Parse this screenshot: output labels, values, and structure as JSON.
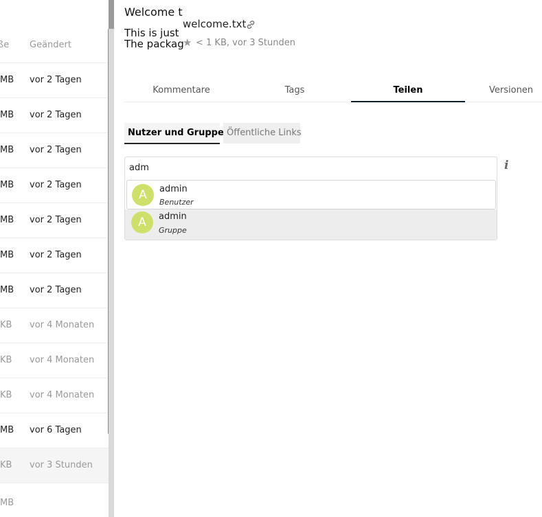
{
  "filelist": {
    "columns": {
      "size": "ße",
      "modified": "Geändert"
    },
    "rows": [
      {
        "size": "MB",
        "modified": "vor 2 Tagen",
        "old": false,
        "selected": false
      },
      {
        "size": "MB",
        "modified": "vor 2 Tagen",
        "old": false,
        "selected": false
      },
      {
        "size": "MB",
        "modified": "vor 2 Tagen",
        "old": false,
        "selected": false
      },
      {
        "size": "MB",
        "modified": "vor 2 Tagen",
        "old": false,
        "selected": false
      },
      {
        "size": "MB",
        "modified": "vor 2 Tagen",
        "old": false,
        "selected": false
      },
      {
        "size": "MB",
        "modified": "vor 2 Tagen",
        "old": false,
        "selected": false
      },
      {
        "size": "MB",
        "modified": "vor 2 Tagen",
        "old": false,
        "selected": false
      },
      {
        "size": "KB",
        "modified": "vor 4 Monaten",
        "old": true,
        "selected": false
      },
      {
        "size": "KB",
        "modified": "vor 4 Monaten",
        "old": true,
        "selected": false
      },
      {
        "size": "KB",
        "modified": "vor 4 Monaten",
        "old": true,
        "selected": false
      },
      {
        "size": "MB",
        "modified": "vor 6 Tagen",
        "old": false,
        "selected": false
      },
      {
        "size": "KB",
        "modified": "vor 3 Stunden",
        "old": true,
        "selected": true
      },
      {
        "size": "MB",
        "modified": "",
        "old": true,
        "selected": false
      }
    ]
  },
  "sidebar": {
    "preview": {
      "line1": "Welcome t",
      "line2": "This is just",
      "line3": "The packag"
    },
    "file_name": "welcome.txt",
    "file_meta": "< 1 KB, vor 3 Stunden",
    "tabs": [
      {
        "label": "Kommentare",
        "active": false
      },
      {
        "label": "Tags",
        "active": false
      },
      {
        "label": "Teilen",
        "active": true
      },
      {
        "label": "Versionen",
        "active": false
      }
    ],
    "subtabs": [
      {
        "label": "Nutzer und Gruppen",
        "active": true
      },
      {
        "label": "Öffentliche Links",
        "active": false
      }
    ],
    "share_input": {
      "value": "adm"
    },
    "suggestions": [
      {
        "initial": "A",
        "name": "admin",
        "type": "Benutzer"
      },
      {
        "initial": "A",
        "name": "admin",
        "type": "Gruppe"
      }
    ],
    "colors": {
      "avatar": "#cfe06a",
      "active_tab_underline": "#0d1a2b"
    }
  }
}
